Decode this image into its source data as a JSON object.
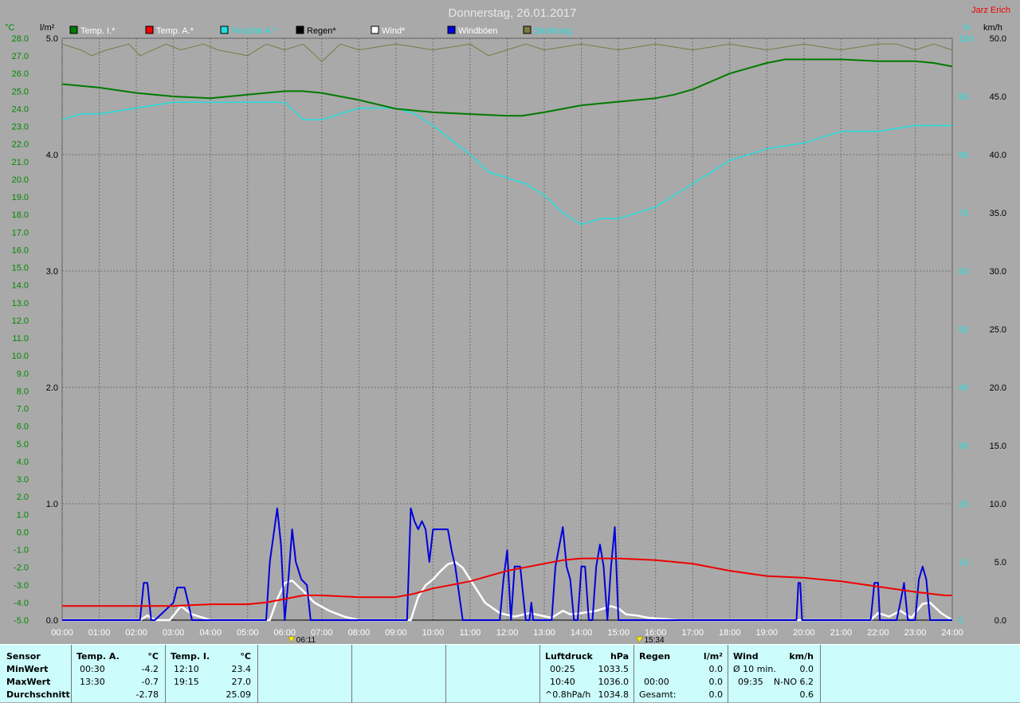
{
  "title": "Donnerstag, 26.01.2017",
  "station_label": "Jarz Erich",
  "axes": {
    "left_unit": "°C",
    "left2_unit": "l/m²",
    "right_unit": "%",
    "right2_unit": "km/h",
    "temp_ticks": [
      "28.0",
      "27.0",
      "26.0",
      "25.0",
      "24.0",
      "23.0",
      "22.0",
      "21.0",
      "20.0",
      "19.0",
      "18.0",
      "17.0",
      "16.0",
      "15.0",
      "14.0",
      "13.0",
      "12.0",
      "11.0",
      "10.0",
      "9.0",
      "8.0",
      "7.0",
      "6.0",
      "5.0",
      "4.0",
      "3.0",
      "2.0",
      "1.0",
      "0.0",
      "-1.0",
      "-2.0",
      "-3.0",
      "-4.0",
      "-5.0"
    ],
    "rain_ticks": [
      "5.0",
      "4.0",
      "3.0",
      "2.0",
      "1.0",
      "0.0"
    ],
    "hum_ticks": [
      "100",
      "90",
      "80",
      "70",
      "60",
      "50",
      "40",
      "30",
      "20",
      "10",
      "0"
    ],
    "wind_ticks": [
      "50.0",
      "45.0",
      "40.0",
      "35.0",
      "30.0",
      "25.0",
      "20.0",
      "15.0",
      "10.0",
      "5.0",
      "0.0"
    ],
    "time_ticks": [
      "00:00",
      "01:00",
      "02:00",
      "03:00",
      "04:00",
      "05:00",
      "06:00",
      "07:00",
      "08:00",
      "09:00",
      "10:00",
      "11:00",
      "12:00",
      "13:00",
      "14:00",
      "15:00",
      "16:00",
      "17:00",
      "18:00",
      "19:00",
      "20:00",
      "21:00",
      "22:00",
      "23:00",
      "24:00"
    ],
    "sunrise": "06:11",
    "sunset": "15:34"
  },
  "colors": {
    "temp_in": "#007a00",
    "temp_out": "#ee0000",
    "humidity": "#22dddd",
    "rain": "#000000",
    "wind": "#ffffff",
    "gust": "#0000dd",
    "radiation": "#7a7a45",
    "axis_green": "#008800",
    "background": "#a9a9a9",
    "panel": "#ccfcfc"
  },
  "chart_data": {
    "type": "line",
    "title": "Donnerstag, 26.01.2017",
    "x_unit": "hours",
    "xlim": [
      0,
      24
    ],
    "ylim_temp": [
      -5,
      28
    ],
    "ylim_rain": [
      0,
      5
    ],
    "ylim_hum": [
      0,
      100
    ],
    "ylim_wind": [
      0,
      50
    ],
    "legend_position": "top",
    "series": [
      {
        "name": "Temp. I.*",
        "axis": "temp",
        "x": [
          0,
          1,
          2,
          3,
          4,
          5,
          6,
          6.5,
          7,
          8,
          9,
          10,
          11,
          12,
          12.4,
          13,
          13.5,
          14,
          15,
          16,
          16.5,
          17,
          18,
          19,
          19.5,
          20,
          21,
          22,
          23,
          23.5,
          24
        ],
        "y": [
          25.4,
          25.2,
          24.9,
          24.7,
          24.6,
          24.8,
          25.0,
          25.0,
          24.9,
          24.5,
          24.0,
          23.8,
          23.7,
          23.6,
          23.6,
          23.8,
          24.0,
          24.2,
          24.4,
          24.6,
          24.8,
          25.1,
          26.0,
          26.6,
          26.8,
          26.8,
          26.8,
          26.7,
          26.7,
          26.6,
          26.4
        ]
      },
      {
        "name": "Temp. A.*",
        "axis": "temp",
        "x": [
          0,
          1,
          2,
          3,
          4,
          5,
          5.5,
          6,
          6.5,
          7,
          8,
          9,
          9.5,
          10,
          10.5,
          11,
          11.5,
          12,
          13,
          13.5,
          14,
          15,
          16,
          17,
          18,
          19,
          20,
          21,
          22,
          23,
          23.8,
          24
        ],
        "y": [
          -4.2,
          -4.2,
          -4.2,
          -4.2,
          -4.1,
          -4.1,
          -4.0,
          -3.8,
          -3.6,
          -3.6,
          -3.7,
          -3.7,
          -3.5,
          -3.2,
          -3.0,
          -2.8,
          -2.5,
          -2.2,
          -1.8,
          -1.6,
          -1.5,
          -1.5,
          -1.6,
          -1.8,
          -2.2,
          -2.5,
          -2.6,
          -2.8,
          -3.1,
          -3.4,
          -3.6,
          -3.6
        ]
      },
      {
        "name": "Feuchte A.*",
        "axis": "hum",
        "x": [
          0,
          0.5,
          1,
          2,
          3,
          4,
          5,
          6,
          6.5,
          7,
          7.5,
          8,
          9,
          9.5,
          10,
          11,
          11.5,
          12,
          12.5,
          13,
          13.5,
          14,
          14.5,
          15,
          16,
          16.5,
          17,
          18,
          19,
          20,
          21,
          22,
          23,
          24
        ],
        "y": [
          86,
          87,
          87,
          88,
          89,
          89,
          89,
          89,
          86,
          86,
          87,
          88,
          88,
          87,
          85,
          80,
          77,
          76,
          75,
          73,
          70,
          68,
          69,
          69,
          71,
          73,
          75,
          79,
          81,
          82,
          84,
          84,
          85,
          85
        ]
      },
      {
        "name": "Regen*",
        "axis": "rain",
        "x": [
          0,
          24
        ],
        "y": [
          0,
          0
        ]
      },
      {
        "name": "Wind*",
        "axis": "wind",
        "x": [
          0,
          2.1,
          2.3,
          2.5,
          2.9,
          3.2,
          3.5,
          4,
          5.6,
          5.8,
          6.0,
          6.2,
          6.5,
          6.8,
          7.2,
          7.6,
          8,
          9.4,
          9.6,
          9.8,
          10.0,
          10.2,
          10.4,
          10.6,
          10.8,
          11.1,
          11.4,
          11.8,
          12.2,
          12.6,
          13.2,
          13.5,
          13.7,
          14.0,
          14.4,
          14.8,
          15.0,
          15.2,
          15.5,
          15.8,
          16.2,
          16.6,
          21.8,
          22.0,
          22.3,
          22.6,
          22.9,
          23.2,
          23.4,
          23.7,
          24
        ],
        "y": [
          0,
          0,
          0.4,
          0,
          0,
          1.2,
          0.5,
          0,
          0,
          1.8,
          3.2,
          3.4,
          2.5,
          1.5,
          0.8,
          0.3,
          0,
          0,
          2.0,
          3.0,
          3.5,
          4.2,
          4.8,
          5.0,
          4.5,
          3.0,
          1.5,
          0.6,
          0.3,
          0.6,
          0.2,
          0.8,
          0.5,
          0.6,
          0.8,
          1.2,
          1.0,
          0.5,
          0.4,
          0.2,
          0.1,
          0,
          0,
          0.6,
          0.3,
          0.8,
          0.2,
          1.4,
          1.5,
          0.6,
          0
        ]
      },
      {
        "name": "Windböen",
        "axis": "wind",
        "x": [
          0,
          2.1,
          2.2,
          2.3,
          2.4,
          2.5,
          3.0,
          3.1,
          3.3,
          3.4,
          3.5,
          5.5,
          5.6,
          5.8,
          5.9,
          6.0,
          6.1,
          6.2,
          6.3,
          6.45,
          6.6,
          6.7,
          6.9,
          7.0,
          9.3,
          9.4,
          9.5,
          9.6,
          9.7,
          9.8,
          9.9,
          10.0,
          10.2,
          10.4,
          10.5,
          10.6,
          10.8,
          10.9,
          11.0,
          11.8,
          11.9,
          12.0,
          12.1,
          12.2,
          12.35,
          12.5,
          12.6,
          12.65,
          12.7,
          13.1,
          13.2,
          13.3,
          13.5,
          13.6,
          13.7,
          13.8,
          13.9,
          14.0,
          14.1,
          14.2,
          14.3,
          14.4,
          14.5,
          14.6,
          14.7,
          14.8,
          14.9,
          15.0,
          15.1,
          15.2,
          15.3,
          15.4,
          15.5,
          15.6,
          15.7,
          19.8,
          19.85,
          19.9,
          19.95,
          20.0,
          21.8,
          21.9,
          22.0,
          22.05,
          22.1,
          22.3,
          22.5,
          22.6,
          22.7,
          22.8,
          22.9,
          23.0,
          23.1,
          23.2,
          23.3,
          23.4,
          23.5,
          23.6,
          23.7,
          24
        ],
        "y": [
          0,
          0,
          3.2,
          3.2,
          0,
          0,
          1.5,
          2.8,
          2.8,
          1.5,
          0,
          0,
          5,
          9.6,
          6.5,
          0,
          3.5,
          7.8,
          5.0,
          3.5,
          3.0,
          0,
          0,
          0,
          0,
          9.6,
          8.5,
          7.8,
          8.5,
          7.8,
          5.0,
          7.8,
          7.8,
          7.8,
          6.0,
          4.6,
          0,
          0,
          0,
          0,
          3.5,
          6.0,
          0,
          4.6,
          4.6,
          0,
          0,
          1.5,
          0,
          0,
          0,
          4.6,
          8.0,
          4.6,
          3.5,
          0,
          0,
          4.6,
          4.6,
          0,
          0,
          4.6,
          6.5,
          4.6,
          0,
          4.6,
          8.0,
          0,
          0,
          0,
          0,
          0,
          0,
          0,
          0,
          0,
          3.2,
          3.2,
          0,
          0,
          0,
          3.2,
          3.2,
          0,
          0,
          0,
          0,
          1.5,
          3.2,
          0,
          0,
          0,
          3.5,
          4.6,
          3.5,
          0,
          0,
          0,
          0,
          0
        ]
      },
      {
        "name": "Strahlung",
        "axis": "hum",
        "x": [
          0,
          0.5,
          0.8,
          1.2,
          1.8,
          2.1,
          2.8,
          3.2,
          3.8,
          4.2,
          5.0,
          5.5,
          6.0,
          6.5,
          7.0,
          7.5,
          8.0,
          9.0,
          10.0,
          11.0,
          11.5,
          12.0,
          12.5,
          13.0,
          14.0,
          15.0,
          16.0,
          17.0,
          18.0,
          19.0,
          20.0,
          21.0,
          22.0,
          22.5,
          23.0,
          23.5,
          24
        ],
        "y": [
          99,
          98,
          97,
          98,
          99,
          97,
          99,
          98,
          99,
          98,
          97,
          99,
          98,
          99,
          96,
          99,
          98,
          99,
          98,
          99,
          97,
          98,
          99,
          98,
          99,
          98,
          99,
          98,
          99,
          98,
          99,
          98,
          99,
          99,
          98,
          99,
          98
        ]
      }
    ]
  },
  "legend": [
    {
      "label": "Temp. I.*",
      "color": "#007a00",
      "text_color": "#ffffff"
    },
    {
      "label": "Temp. A.*",
      "color": "#ee0000",
      "text_color": "#ffffff"
    },
    {
      "label": "Feuchte A.*",
      "color": "#22dddd",
      "text_color": "#22dddd"
    },
    {
      "label": "Regen*",
      "color": "#000000",
      "text_color": "#000000"
    },
    {
      "label": "Wind*",
      "color": "#ffffff",
      "text_color": "#ffffff"
    },
    {
      "label": "Windböen",
      "color": "#0000dd",
      "text_color": "#ffffff"
    },
    {
      "label": "Strahlung",
      "color": "#7a7a45",
      "text_color": "#22dddd"
    }
  ],
  "panel": {
    "sensor": {
      "header": "Sensor",
      "min": "MinWert",
      "max": "MaxWert",
      "avg": "Durchschnitt"
    },
    "temp_out": {
      "header": "Temp. A.",
      "unit": "°C",
      "min_time": "00:30",
      "min_val": "-4.2",
      "max_time": "13:30",
      "max_val": "-0.7",
      "avg_val": "-2.78"
    },
    "temp_in": {
      "header": "Temp. I.",
      "unit": "°C",
      "min_time": "12:10",
      "min_val": "23.4",
      "max_time": "19:15",
      "max_val": "27.0",
      "avg_val": "25.09"
    },
    "pressure": {
      "header": "Luftdruck",
      "unit": "hPa",
      "min_time": "00:25",
      "min_val": "1033.5",
      "max_time": "10:40",
      "max_val": "1036.0",
      "trend": "^0.8hPa/h",
      "avg_val": "1034.8"
    },
    "rain": {
      "header": "Regen",
      "unit": "l/m²",
      "day_val": "0.0",
      "time": "00:00",
      "hour_val": "0.0",
      "total_label": "Gesamt:",
      "total_val": "0.0"
    },
    "wind": {
      "header": "Wind",
      "unit": "km/h",
      "avg_label": "Ø 10 min.",
      "avg_val": "0.0",
      "max_time": "09:35",
      "max_dir": "N-NO 6.2",
      "avg2_val": "0.6"
    }
  }
}
